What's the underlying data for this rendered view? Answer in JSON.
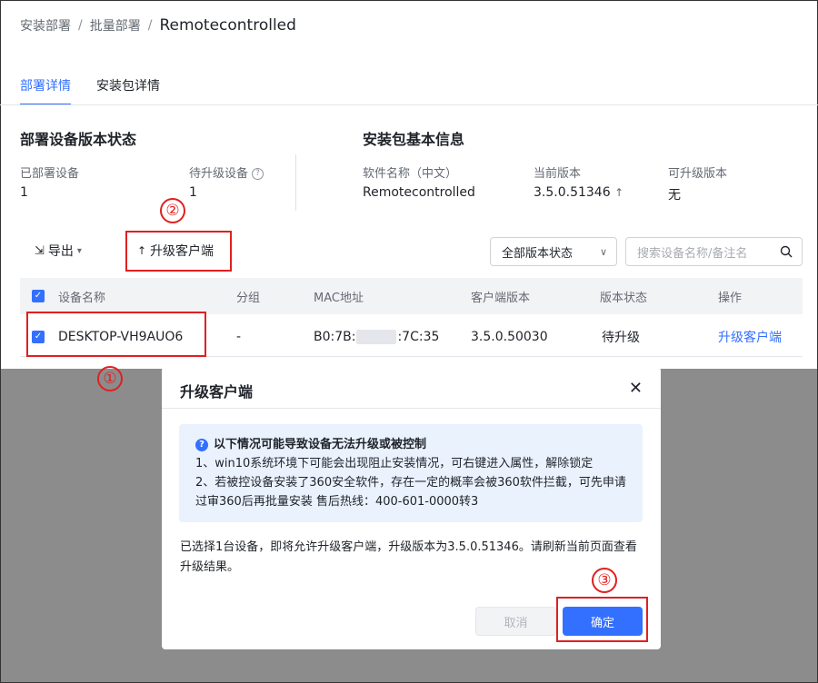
{
  "breadcrumb": {
    "items": [
      "安装部署",
      "批量部署"
    ],
    "current": "Remotecontrolled"
  },
  "tabs": [
    {
      "label": "部署详情",
      "active": true
    },
    {
      "label": "安装包详情",
      "active": false
    }
  ],
  "deploy_status": {
    "title": "部署设备版本状态",
    "deployed_label": "已部署设备",
    "deployed_value": "1",
    "pending_label": "待升级设备",
    "pending_value": "1"
  },
  "package_info": {
    "title": "安装包基本信息",
    "name_label": "软件名称（中文）",
    "name_value": "Remotecontrolled",
    "current_label": "当前版本",
    "current_value": "3.5.0.51346",
    "upgradable_label": "可升级版本",
    "upgradable_value": "无"
  },
  "toolbar": {
    "export_label": "导出",
    "upgrade_label": "升级客户端",
    "status_select": "全部版本状态",
    "search_placeholder": "搜索设备名称/备注名"
  },
  "table": {
    "headers": [
      "设备名称",
      "分组",
      "MAC地址",
      "客户端版本",
      "版本状态",
      "操作"
    ],
    "rows": [
      {
        "device": "DESKTOP-VH9AUO6",
        "group": "-",
        "mac_start": "B0:7B:",
        "mac_end": ":7C:35",
        "client_version": "3.5.0.50030",
        "status": "待升级",
        "action": "升级客户端"
      }
    ]
  },
  "modal": {
    "title": "升级客户端",
    "notice_title": "以下情况可能导致设备无法升级或被控制",
    "notice_line1": "1、win10系统环境下可能会出现阻止安装情况，可右键进入属性，解除锁定",
    "notice_line2": "2、若被控设备安装了360安全软件，存在一定的概率会被360软件拦截，可先申请过审360后再批量安装 售后热线：400-601-0000转3",
    "body_text": "已选择1台设备，即将允许升级客户端，升级版本为3.5.0.51346。请刷新当前页面查看升级结果。",
    "cancel_label": "取消",
    "ok_label": "确定"
  },
  "annotations": {
    "n1": "①",
    "n2": "②",
    "n3": "③",
    "color": "#e02020"
  },
  "colors": {
    "accent": "#3370ff",
    "annotation": "#e02020"
  },
  "icons": [
    "export-icon",
    "chevron-down-icon",
    "upgrade-arrow-icon",
    "search-icon",
    "question-icon",
    "checkbox-checked-icon",
    "close-icon",
    "info-icon"
  ]
}
